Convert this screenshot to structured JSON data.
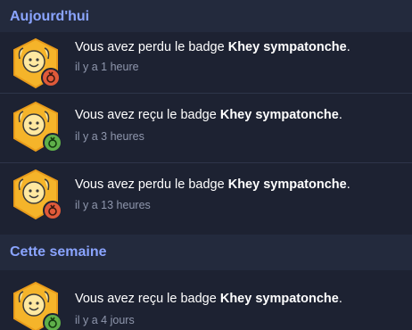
{
  "sections": {
    "today": "Aujourd'hui",
    "this_week": "Cette semaine"
  },
  "notifications": [
    {
      "prefix": "Vous avez perdu le badge ",
      "badge": "Khey sympatonche",
      "suffix": ".",
      "time": "il y a 1 heure",
      "status": "lost",
      "status_color": "#e05a3a"
    },
    {
      "prefix": "Vous avez reçu le badge ",
      "badge": "Khey sympatonche",
      "suffix": ".",
      "time": "il y a 3 heures",
      "status": "received",
      "status_color": "#5fb04a"
    },
    {
      "prefix": "Vous avez perdu le badge ",
      "badge": "Khey sympatonche",
      "suffix": ".",
      "time": "il y a 13 heures",
      "status": "lost",
      "status_color": "#e05a3a"
    },
    {
      "prefix": "Vous avez reçu le badge ",
      "badge": "Khey sympatonche",
      "suffix": ".",
      "time": "il y a 4 jours",
      "status": "received",
      "status_color": "#5fb04a"
    }
  ],
  "colors": {
    "background": "#1d2232",
    "header_background": "#232a3d",
    "header_text": "#8aa4ff",
    "secondary_text": "#8f97ad",
    "badge_hex": "#f5b42a"
  },
  "icons": {
    "avatar": "smiley-badge-hexagon-icon",
    "status": "medal-icon"
  }
}
